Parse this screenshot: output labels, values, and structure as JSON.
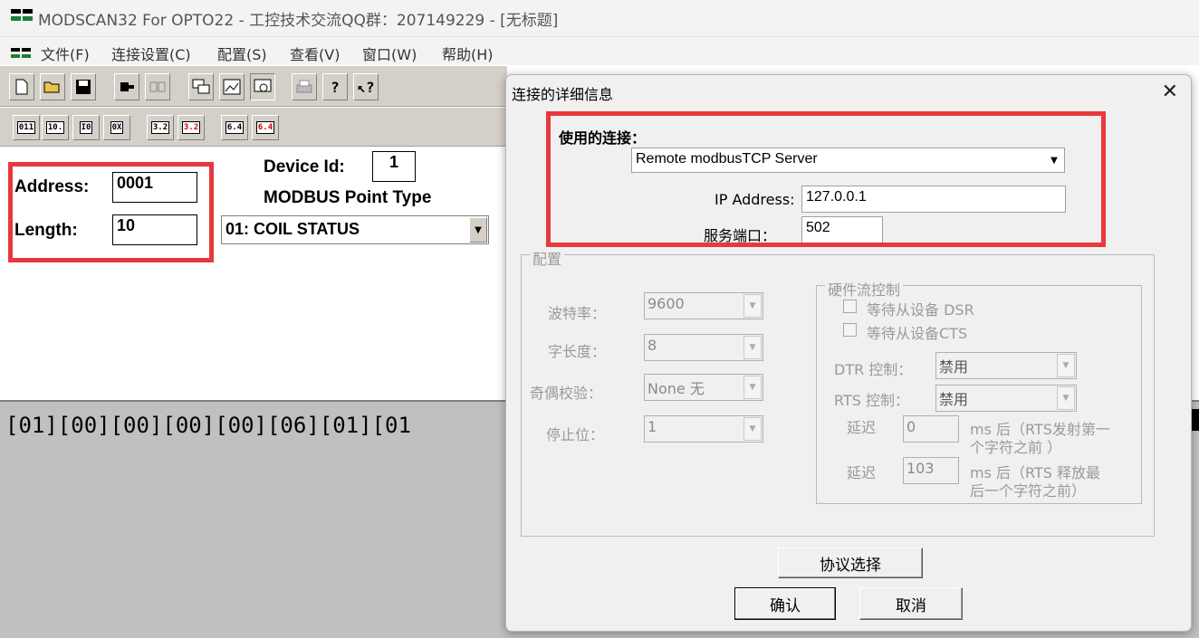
{
  "window": {
    "title": "MODSCAN32 For OPTO22 - 工控技术交流QQ群：207149229 - [无标题]"
  },
  "menu": [
    "文件(F)",
    "连接设置(C)",
    "配置(S)",
    "查看(V)",
    "窗口(W)",
    "帮助(H)"
  ],
  "form": {
    "address_label": "Address:",
    "address_value": "0001",
    "length_label": "Length:",
    "length_value": "10",
    "device_id_label": "Device Id:",
    "device_id_value": "1",
    "point_type_label": "MODBUS Point Type",
    "point_type_value": "01: COIL STATUS"
  },
  "toolbar2_labels": [
    "011",
    "10.",
    "I0",
    "0X",
    "3.2",
    "3.2",
    "6.4",
    "6.4"
  ],
  "data_pane": {
    "text": "[01][00][00][00][00][06][01][01"
  },
  "dialog": {
    "title": "连接的详细信息",
    "close": "✕",
    "connection_label": "使用的连接：",
    "connection_value": "Remote modbusTCP Server",
    "ip_label": "IP Address:",
    "ip_value": "127.0.0.1",
    "port_label": "服务端口：",
    "port_value": "502",
    "config_group": "配置",
    "baud_label": "波特率：",
    "baud_value": "9600",
    "wordlen_label": "字长度：",
    "wordlen_value": "8",
    "parity_label": "奇偶校验：",
    "parity_value": "None 无",
    "stopbit_label": "停止位：",
    "stopbit_value": "1",
    "flow_group": "硬件流控制",
    "dsr_label": "等待从设备 DSR",
    "cts_label": "等待从设备CTS",
    "dtr_label": "DTR 控制：",
    "dtr_value": "禁用",
    "rts_label": "RTS 控制：",
    "rts_value": "禁用",
    "delay1_label": "延迟",
    "delay1_value": "0",
    "delay1_note_line1": "ms 后（RTS发射第一",
    "delay1_note_line2": "个字符之前 ）",
    "delay2_label": "延迟",
    "delay2_value": "103",
    "delay2_note_line1": "ms 后（RTS 释放最",
    "delay2_note_line2": "后一个字符之前）",
    "protocol_button": "协议选择",
    "ok_button": "确认",
    "cancel_button": "取消"
  },
  "colors": {
    "highlight_box": "#e8383d",
    "toolbar": "#d4d0c8",
    "data_pane": "#c0c0c0"
  },
  "icons": [
    "app-icon",
    "new-icon",
    "open-icon",
    "save-icon",
    "connect-icon",
    "disconnect-icon",
    "print-icon",
    "help-icon",
    "context-help-icon"
  ]
}
